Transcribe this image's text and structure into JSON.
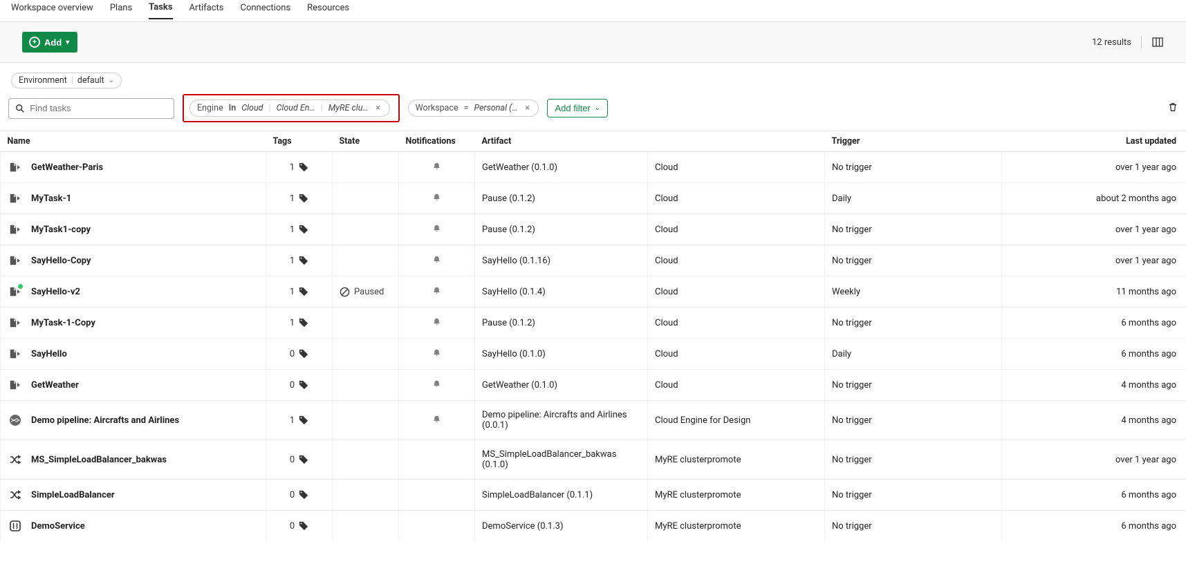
{
  "nav": {
    "tabs": [
      {
        "label": "Workspace overview",
        "active": false
      },
      {
        "label": "Plans",
        "active": false
      },
      {
        "label": "Tasks",
        "active": true
      },
      {
        "label": "Artifacts",
        "active": false
      },
      {
        "label": "Connections",
        "active": false
      },
      {
        "label": "Resources",
        "active": false
      }
    ]
  },
  "toolbar": {
    "add_label": "Add",
    "results_text": "12 results"
  },
  "env": {
    "label": "Environment",
    "value": "default"
  },
  "search": {
    "placeholder": "Find tasks"
  },
  "filters": {
    "engine": {
      "key": "Engine",
      "op": "In",
      "v1": "Cloud",
      "v2": "Cloud En…",
      "v3": "MyRE clu…"
    },
    "workspace": {
      "key": "Workspace",
      "op": "=",
      "value": "Personal (…"
    },
    "add_filter_label": "Add filter"
  },
  "columns": {
    "name": "Name",
    "tags": "Tags",
    "state": "State",
    "notifications": "Notifications",
    "artifact": "Artifact",
    "trigger": "Trigger",
    "updated": "Last updated"
  },
  "rows": [
    {
      "icon": "task",
      "name": "GetWeather-Paris",
      "tags": "1",
      "state": "",
      "artifact": "GetWeather (0.1.0)",
      "engine": "Cloud",
      "trigger": "No trigger",
      "updated": "over 1 year ago",
      "notif": true
    },
    {
      "icon": "task",
      "name": "MyTask-1",
      "tags": "1",
      "state": "",
      "artifact": "Pause (0.1.2)",
      "engine": "Cloud",
      "trigger": "Daily",
      "updated": "about 2 months ago",
      "notif": true
    },
    {
      "icon": "task",
      "name": "MyTask1-copy",
      "tags": "1",
      "state": "",
      "artifact": "Pause (0.1.2)",
      "engine": "Cloud",
      "trigger": "No trigger",
      "updated": "over 1 year ago",
      "notif": true
    },
    {
      "icon": "task",
      "name": "SayHello-Copy",
      "tags": "1",
      "state": "",
      "artifact": "SayHello (0.1.16)",
      "engine": "Cloud",
      "trigger": "No trigger",
      "updated": "over 1 year ago",
      "notif": true
    },
    {
      "icon": "task-dot",
      "name": "SayHello-v2",
      "tags": "1",
      "state": "Paused",
      "artifact": "SayHello (0.1.4)",
      "engine": "Cloud",
      "trigger": "Weekly",
      "updated": "11 months ago",
      "notif": true
    },
    {
      "icon": "task",
      "name": "MyTask-1-Copy",
      "tags": "1",
      "state": "",
      "artifact": "Pause (0.1.2)",
      "engine": "Cloud",
      "trigger": "No trigger",
      "updated": "6 months ago",
      "notif": true
    },
    {
      "icon": "task",
      "name": "SayHello",
      "tags": "0",
      "state": "",
      "artifact": "SayHello (0.1.0)",
      "engine": "Cloud",
      "trigger": "Daily",
      "updated": "6 months ago",
      "notif": true
    },
    {
      "icon": "task",
      "name": "GetWeather",
      "tags": "0",
      "state": "",
      "artifact": "GetWeather (0.1.0)",
      "engine": "Cloud",
      "trigger": "No trigger",
      "updated": "4 months ago",
      "notif": true
    },
    {
      "icon": "pipeline",
      "name": "Demo pipeline: Aircrafts and Airlines",
      "tags": "1",
      "state": "",
      "artifact": "Demo pipeline: Aircrafts and Airlines (0.0.1)",
      "engine": "Cloud Engine for Design",
      "trigger": "No trigger",
      "updated": "4 months ago",
      "notif": true
    },
    {
      "icon": "shuffle",
      "name": "MS_SimpleLoadBalancer_bakwas",
      "tags": "0",
      "state": "",
      "artifact": "MS_SimpleLoadBalancer_bakwas (0.1.0)",
      "engine": "MyRE clusterpromote",
      "trigger": "No trigger",
      "updated": "over 1 year ago",
      "notif": false
    },
    {
      "icon": "shuffle",
      "name": "SimpleLoadBalancer",
      "tags": "0",
      "state": "",
      "artifact": "SimpleLoadBalancer (0.1.1)",
      "engine": "MyRE clusterpromote",
      "trigger": "No trigger",
      "updated": "6 months ago",
      "notif": false
    },
    {
      "icon": "service",
      "name": "DemoService",
      "tags": "0",
      "state": "",
      "artifact": "DemoService (0.1.3)",
      "engine": "MyRE clusterpromote",
      "trigger": "No trigger",
      "updated": "6 months ago",
      "notif": false
    }
  ]
}
